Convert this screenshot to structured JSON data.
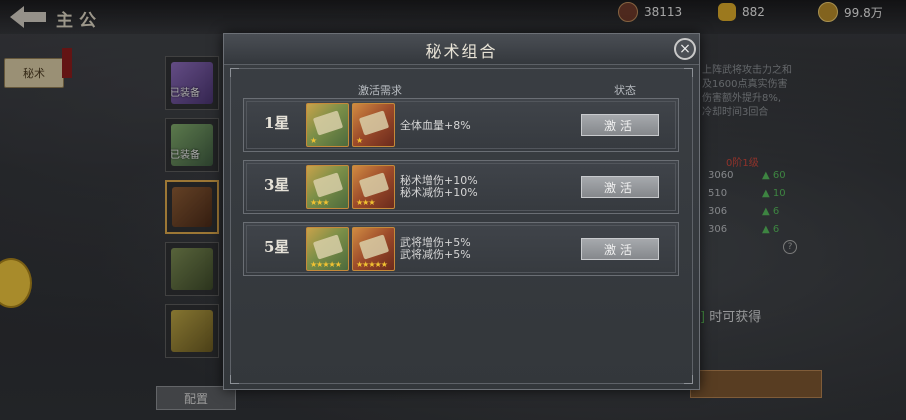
{
  "header": {
    "title": "主公",
    "resources": [
      {
        "icon": "power-icon",
        "value": "38113"
      },
      {
        "icon": "gold-ingot-icon",
        "value": "882"
      },
      {
        "icon": "coin-icon",
        "value": "99.8万"
      }
    ]
  },
  "left_tab": {
    "label": "秘术"
  },
  "book_list": [
    {
      "tag": "已装备",
      "color": "purple"
    },
    {
      "tag": "已装备",
      "color": "green"
    },
    {
      "tag": "",
      "color": "brown-locked"
    },
    {
      "tag": "",
      "color": "green-locked"
    },
    {
      "tag": "",
      "color": "yellow-locked"
    }
  ],
  "config_button": "配置",
  "right_panel": {
    "desc_lines": [
      "上阵武将攻击力之和",
      "及1600点真实伤害",
      "伤害额外提升8%,",
      "冷却时间3回合"
    ],
    "level": "0阶1级",
    "stats": [
      {
        "base": "3060",
        "bonus": "60"
      },
      {
        "base": "510",
        "bonus": "10"
      },
      {
        "base": "306",
        "bonus": "6"
      },
      {
        "base": "306",
        "bonus": "6"
      }
    ],
    "gain_text": "时可获得",
    "help": "?"
  },
  "modal": {
    "title": "秘术组合",
    "close": "×",
    "col_requirement": "激活需求",
    "col_status": "状态",
    "combos": [
      {
        "stars_label": "1星",
        "star_count": "★",
        "effects": [
          "全体血量+8%"
        ],
        "button": "激活"
      },
      {
        "stars_label": "3星",
        "star_count": "★★★",
        "effects": [
          "秘术增伤+10%",
          "秘术减伤+10%"
        ],
        "button": "激活"
      },
      {
        "stars_label": "5星",
        "star_count": "★★★★★",
        "effects": [
          "武将增伤+5%",
          "武将减伤+5%"
        ],
        "button": "激活"
      }
    ]
  },
  "colors": {
    "accent_gold": "#d9a64a",
    "stat_green": "#55b85a",
    "level_red": "#c8463b"
  }
}
